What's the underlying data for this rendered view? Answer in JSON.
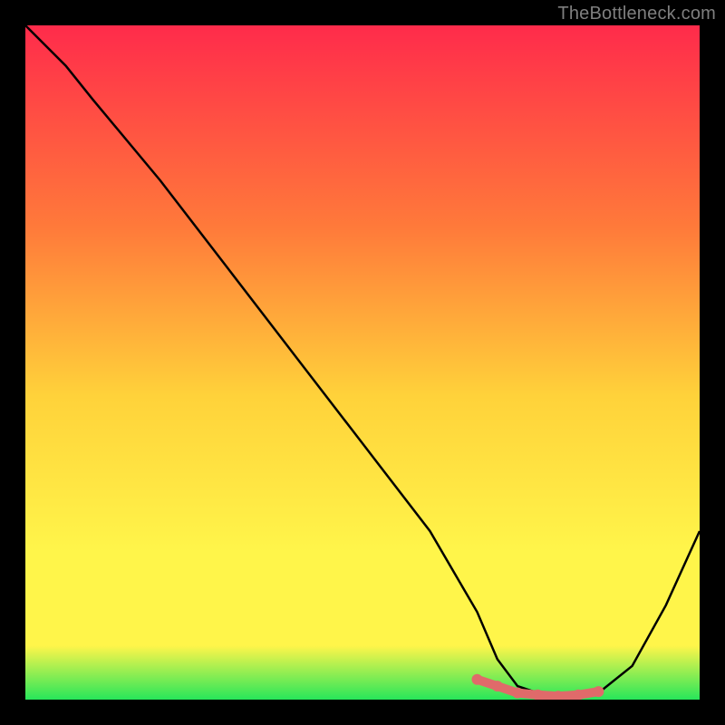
{
  "attribution": "TheBottleneck.com",
  "colors": {
    "page_bg": "#000000",
    "attribution_text": "#7f7f7f",
    "gradient_top": "#ff2b4b",
    "gradient_mid1": "#ff7a3a",
    "gradient_mid2": "#ffd23a",
    "gradient_mid3": "#fff54a",
    "gradient_bottom": "#27e65a",
    "curve": "#000000",
    "marker": "#e06a6a"
  },
  "chart_data": {
    "type": "line",
    "title": "",
    "xlabel": "",
    "ylabel": "",
    "xlim": [
      0,
      100
    ],
    "ylim": [
      0,
      100
    ],
    "x": [
      0,
      6,
      10,
      20,
      30,
      40,
      50,
      60,
      67,
      70,
      73,
      76,
      79,
      82,
      85,
      90,
      95,
      100
    ],
    "values": [
      100,
      94,
      89,
      77,
      64,
      51,
      38,
      25,
      13,
      6,
      2,
      1,
      0.5,
      0.5,
      1,
      5,
      14,
      25
    ],
    "marker_region": {
      "x": [
        67,
        70,
        73,
        76,
        79,
        82,
        85
      ],
      "y": [
        3,
        2,
        1,
        0.7,
        0.5,
        0.7,
        1.2
      ]
    }
  }
}
